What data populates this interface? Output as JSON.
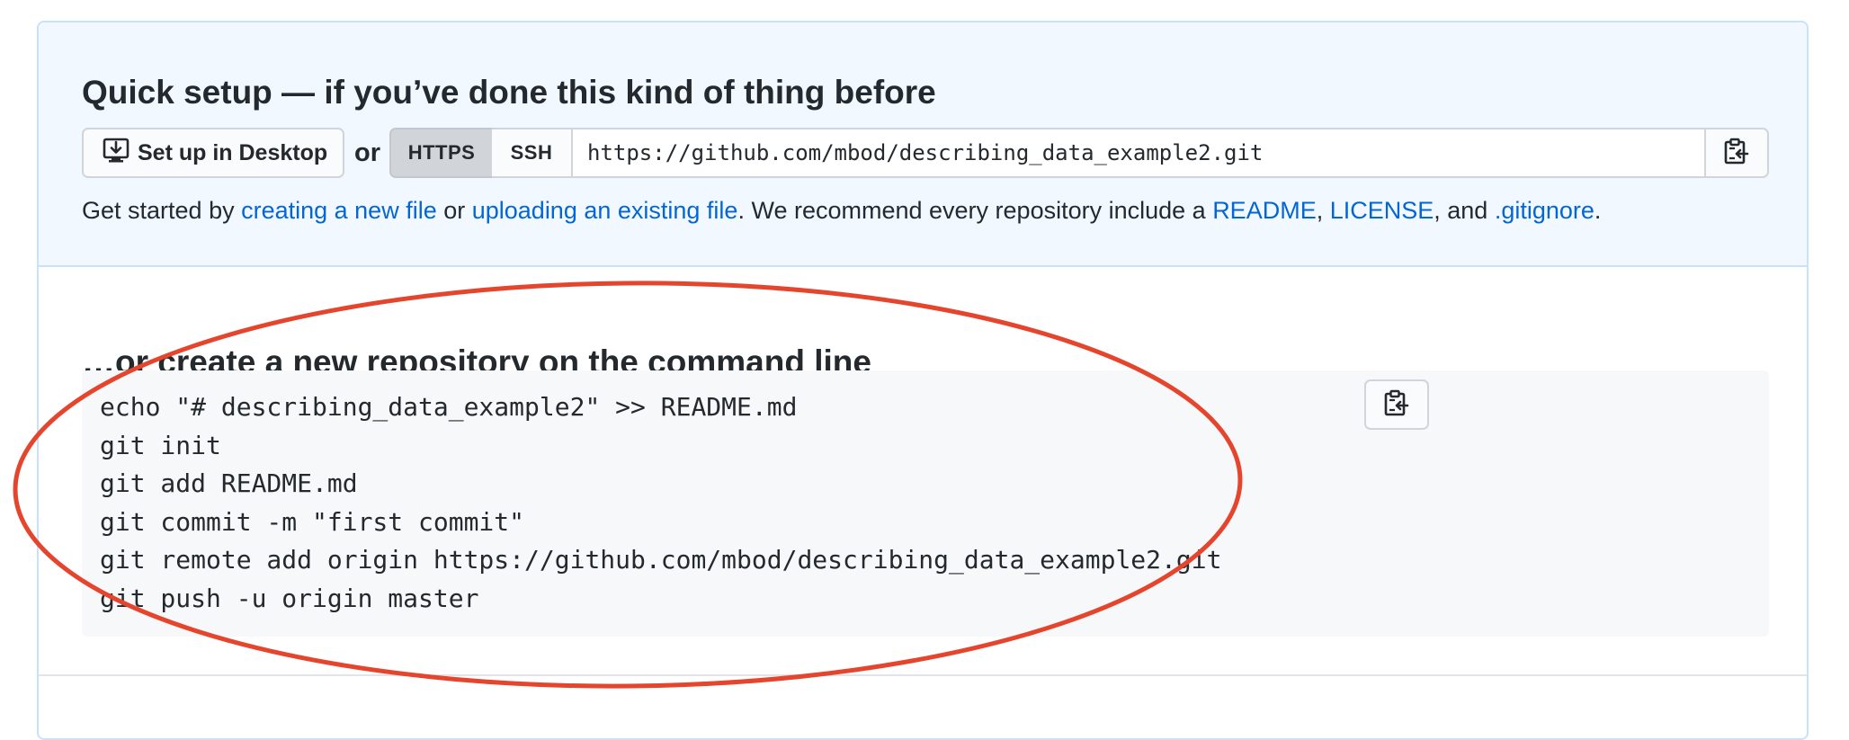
{
  "quick_setup": {
    "title": "Quick setup — if you’ve done this kind of thing before",
    "desktop_button_label": "Set up in Desktop",
    "or_label": "or",
    "protocols": [
      {
        "label": "HTTPS",
        "selected": true
      },
      {
        "label": "SSH",
        "selected": false
      }
    ],
    "clone_url": "https://github.com/mbod/describing_data_example2.git",
    "help": {
      "prefix": "Get started by ",
      "link_new_file": "creating a new file",
      "middle": " or ",
      "link_upload": "uploading an existing file",
      "recommend": ". We recommend every repository include a ",
      "link_readme": "README",
      "comma": ", ",
      "link_license": "LICENSE",
      "and": ", and ",
      "link_gitignore": ".gitignore",
      "end": "."
    }
  },
  "command_line": {
    "title": "…or create a new repository on the command line",
    "lines": [
      "echo \"# describing_data_example2\" >> README.md",
      "git init",
      "git add README.md",
      "git commit -m \"first commit\"",
      "git remote add origin https://github.com/mbod/describing_data_example2.git",
      "git push -u origin master"
    ]
  },
  "icons": {
    "desktop": "download-desktop-icon",
    "copy": "clipboard-copy-icon"
  },
  "colors": {
    "link": "#0366d6",
    "quick_setup_bg": "#f1f8ff",
    "panel_border": "#c8e1ff",
    "code_bg": "#f6f8fa",
    "annotation_ellipse": "#e5452c"
  }
}
